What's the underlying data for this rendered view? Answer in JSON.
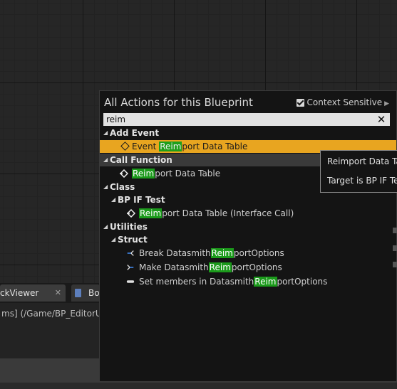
{
  "menu": {
    "title": "All Actions for this Blueprint",
    "context_sensitive_label": "Context Sensitive",
    "context_sensitive_checked": true,
    "search_value": "reim",
    "categories": {
      "add_event": "Add Event",
      "call_function": "Call Function",
      "class": "Class",
      "bp_if_test": "BP IF Test",
      "utilities": "Utilities",
      "struct": "Struct"
    },
    "items": {
      "event_reimport": {
        "pre": "Event ",
        "hl": "Reim",
        "post": "port Data Table"
      },
      "reimport_data_table": {
        "pre": "",
        "hl": "Reim",
        "post": "port Data Table"
      },
      "reimport_interface_call": {
        "pre": "",
        "hl": "Reim",
        "post": "port Data Table (Interface Call)"
      },
      "break_options": {
        "pre": "Break Datasmith",
        "hl": "Reim",
        "post": "portOptions"
      },
      "make_options": {
        "pre": "Make Datasmith",
        "hl": "Reim",
        "post": "portOptions"
      },
      "set_members": {
        "pre": "Set members in Datasmith",
        "hl": "Reim",
        "post": "portOptions"
      }
    }
  },
  "tooltip": {
    "line1": "Reimport Data Table",
    "line2": "Target is BP IF Test"
  },
  "bottom": {
    "tab1_label": "ckViewer",
    "tab1_close": "✕",
    "tab2_label": "Bo",
    "path_text": "ms] (/Game/BP_EditorUti"
  },
  "colors": {
    "selection": "#e8a520",
    "highlight": "#1b9a1b",
    "menu_bg": "#141414"
  }
}
